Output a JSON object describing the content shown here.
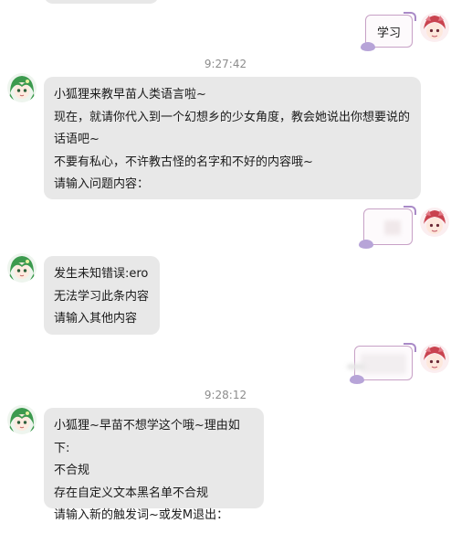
{
  "messages": {
    "sent_1": {
      "text": "学习"
    },
    "time_1": "9:27:42",
    "received_1": {
      "lines": [
        "小狐狸来教早苗人类语言啦~",
        "现在，就请你代入到一个幻想乡的少女角度，教会她说出你想要说的",
        "话语吧~",
        "不要有私心，不许教古怪的名字和不好的内容哦~",
        "请输入问题内容："
      ]
    },
    "received_2": {
      "lines": [
        "发生未知错误:ero",
        "无法学习此条内容",
        "请输入其他内容"
      ]
    },
    "time_2": "9:28:12",
    "received_3": {
      "lines": [
        "小狐狸~早苗不想学这个哦~理由如下:",
        "不合规",
        "存在自定义文本黑名单不合规",
        "请输入新的触发词~或发M退出："
      ]
    }
  },
  "colors": {
    "bubble_in": "#e8e8e8",
    "bubble_out_border": "#c7a1c6",
    "timestamp": "#8c8c8c"
  },
  "icons": {
    "bot_avatar": "green-haired-girl-avatar",
    "user_avatar": "pink-red-haired-girl-avatar"
  }
}
